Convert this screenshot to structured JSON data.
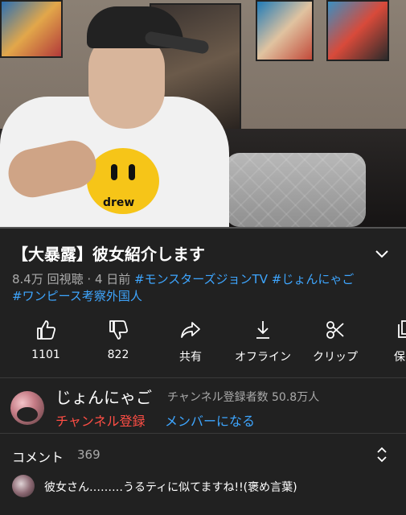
{
  "video": {
    "shirt_word": "drew"
  },
  "title": "【大暴露】彼女紹介します",
  "meta": {
    "views": "8.4万 回視聴",
    "separator": " · ",
    "age": "4 日前",
    "tags": [
      "#モンスターズジョンTV",
      "#じょんにゃご",
      "#ワンピース考察外国人"
    ]
  },
  "actions": [
    {
      "icon": "thumbs-up-icon",
      "label": "1101"
    },
    {
      "icon": "thumbs-down-icon",
      "label": "822"
    },
    {
      "icon": "share-icon",
      "label": "共有"
    },
    {
      "icon": "download-icon",
      "label": "オフライン"
    },
    {
      "icon": "scissors-icon",
      "label": "クリップ"
    },
    {
      "icon": "save-icon",
      "label": "保"
    }
  ],
  "channel": {
    "name": "じょんにゃご",
    "subscribers": "チャンネル登録者数 50.8万人",
    "subscribe_label": "チャンネル登録",
    "member_label": "メンバーになる"
  },
  "comments": {
    "label": "コメント",
    "count": "369",
    "top_comment": "彼女さん………うるティに似てますね!!(褒め言葉)"
  },
  "colors": {
    "background": "#212121",
    "link": "#3ea6ff",
    "subscribe": "#ff4e45",
    "secondary_text": "#aaaaaa"
  }
}
